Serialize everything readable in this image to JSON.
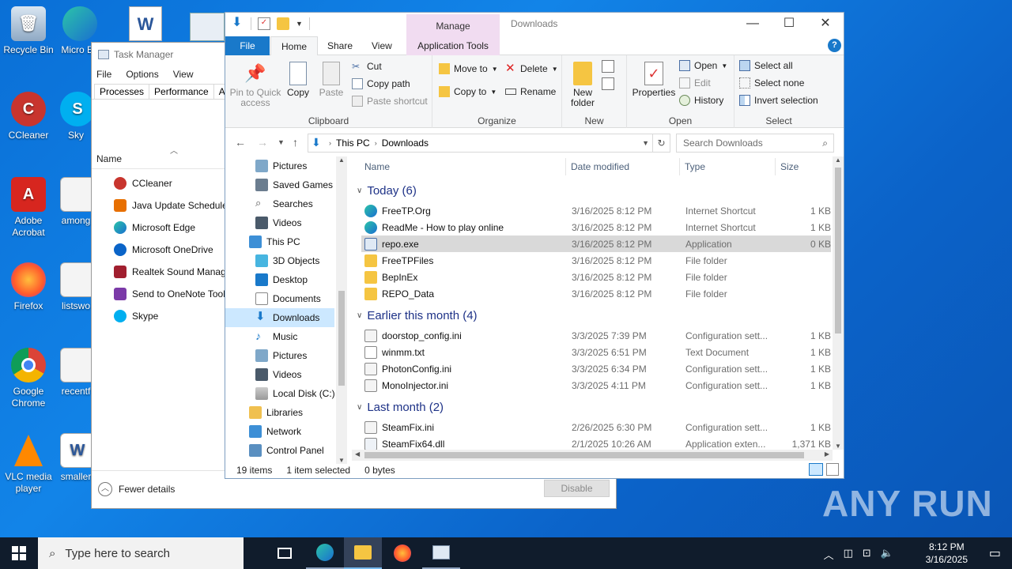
{
  "desktop": {
    "icons": [
      {
        "label": "Recycle Bin"
      },
      {
        "label": "CCleaner"
      },
      {
        "label": "Adobe Acrobat"
      },
      {
        "label": "Firefox"
      },
      {
        "label": "Google Chrome"
      },
      {
        "label": "VLC media player"
      },
      {
        "label": "Micro Ed"
      },
      {
        "label": "Sky"
      },
      {
        "label": "among"
      },
      {
        "label": "listswo"
      },
      {
        "label": "recentf"
      },
      {
        "label": "smaller"
      }
    ]
  },
  "taskmgr": {
    "title": "Task Manager",
    "menu": [
      "File",
      "Options",
      "View"
    ],
    "tabs": [
      "Processes",
      "Performance",
      "App"
    ],
    "name_header": "Name",
    "apps": [
      "CCleaner",
      "Java Update Scheduler",
      "Microsoft Edge",
      "Microsoft OneDrive",
      "Realtek Sound Manage",
      "Send to OneNote Tool",
      "Skype"
    ],
    "fewer_details": "Fewer details",
    "disable": "Disable"
  },
  "explorer": {
    "title": "Downloads",
    "manage": "Manage",
    "tabs": {
      "file": "File",
      "home": "Home",
      "share": "Share",
      "view": "View",
      "app_tools": "Application Tools"
    },
    "ribbon": {
      "clipboard": {
        "label": "Clipboard",
        "pin": "Pin to Quick access",
        "copy": "Copy",
        "paste": "Paste",
        "cut": "Cut",
        "copy_path": "Copy path",
        "paste_shortcut": "Paste shortcut"
      },
      "organize": {
        "label": "Organize",
        "move_to": "Move to",
        "copy_to": "Copy to",
        "delete": "Delete",
        "rename": "Rename"
      },
      "new": {
        "label": "New",
        "new_folder": "New folder"
      },
      "open": {
        "label": "Open",
        "properties": "Properties",
        "open": "Open",
        "edit": "Edit",
        "history": "History"
      },
      "select": {
        "label": "Select",
        "select_all": "Select all",
        "select_none": "Select none",
        "invert": "Invert selection"
      }
    },
    "breadcrumb": [
      "This PC",
      "Downloads"
    ],
    "search_placeholder": "Search Downloads",
    "nav": [
      "Pictures",
      "Saved Games",
      "Searches",
      "Videos",
      "This PC",
      "3D Objects",
      "Desktop",
      "Documents",
      "Downloads",
      "Music",
      "Pictures",
      "Videos",
      "Local Disk (C:)",
      "Libraries",
      "Network",
      "Control Panel"
    ],
    "columns": {
      "name": "Name",
      "date": "Date modified",
      "type": "Type",
      "size": "Size"
    },
    "groups": [
      {
        "title": "Today (6)",
        "files": [
          {
            "name": "FreeTP.Org",
            "date": "3/16/2025 8:12 PM",
            "type": "Internet Shortcut",
            "size": "1 KB"
          },
          {
            "name": "ReadMe - How to play online",
            "date": "3/16/2025 8:12 PM",
            "type": "Internet Shortcut",
            "size": "1 KB"
          },
          {
            "name": "repo.exe",
            "date": "3/16/2025 8:12 PM",
            "type": "Application",
            "size": "0 KB"
          },
          {
            "name": "FreeTPFiles",
            "date": "3/16/2025 8:12 PM",
            "type": "File folder",
            "size": ""
          },
          {
            "name": "BepInEx",
            "date": "3/16/2025 8:12 PM",
            "type": "File folder",
            "size": ""
          },
          {
            "name": "REPO_Data",
            "date": "3/16/2025 8:12 PM",
            "type": "File folder",
            "size": ""
          }
        ]
      },
      {
        "title": "Earlier this month (4)",
        "files": [
          {
            "name": "doorstop_config.ini",
            "date": "3/3/2025 7:39 PM",
            "type": "Configuration sett...",
            "size": "1 KB"
          },
          {
            "name": "winmm.txt",
            "date": "3/3/2025 6:51 PM",
            "type": "Text Document",
            "size": "1 KB"
          },
          {
            "name": "PhotonConfig.ini",
            "date": "3/3/2025 6:34 PM",
            "type": "Configuration sett...",
            "size": "1 KB"
          },
          {
            "name": "MonoInjector.ini",
            "date": "3/3/2025 4:11 PM",
            "type": "Configuration sett...",
            "size": "1 KB"
          }
        ]
      },
      {
        "title": "Last month (2)",
        "files": [
          {
            "name": "SteamFix.ini",
            "date": "2/26/2025 6:30 PM",
            "type": "Configuration sett...",
            "size": "1 KB"
          },
          {
            "name": "SteamFix64.dll",
            "date": "2/1/2025 10:26 AM",
            "type": "Application exten...",
            "size": "1,371 KB"
          }
        ]
      }
    ],
    "status": {
      "items": "19 items",
      "selected": "1 item selected",
      "bytes": "0 bytes"
    }
  },
  "taskbar": {
    "search_placeholder": "Type here to search",
    "time": "8:12 PM",
    "date": "3/16/2025"
  },
  "watermark": "ANY RUN",
  "colors": {
    "accent": "#1979ca",
    "selection": "#cce8ff",
    "taskbar": "#101c2c"
  }
}
